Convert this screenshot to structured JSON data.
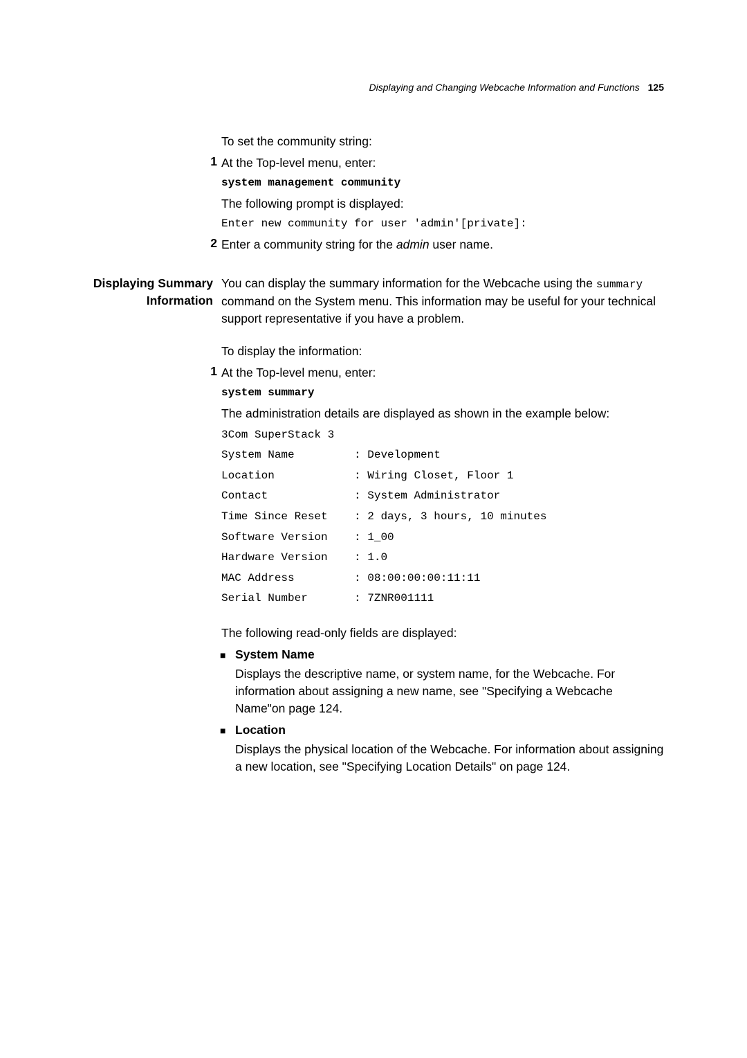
{
  "runningHead": {
    "title": "Displaying and Changing Webcache Information and Functions",
    "pageNumber": "125"
  },
  "topBlock": {
    "intro": "To set the community string:",
    "step1": "At the Top-level menu, enter:",
    "step1cmd": "system management community",
    "step1after": "The following prompt is displayed:",
    "step1output": "Enter new community for user 'admin'[private]:",
    "step2a": "Enter a community string for the ",
    "step2italic": "admin",
    "step2b": " user name.",
    "num1": "1",
    "num2": "2"
  },
  "section": {
    "sideHead": "Displaying Summary Information",
    "para1a": "You can display the summary information for the Webcache using the ",
    "para1mono": "summary",
    "para1b": " command on the System menu. This information may be useful for your technical support representative if you have a problem.",
    "para2": "To display the information:",
    "step1num": "1",
    "step1": "At the Top-level menu, enter:",
    "step1cmd": "system summary",
    "step1after": "The administration details are displayed as shown in the example below:",
    "output": "3Com SuperStack 3\nSystem Name         : Development\nLocation            : Wiring Closet, Floor 1\nContact             : System Administrator\nTime Since Reset    : 2 days, 3 hours, 10 minutes\nSoftware Version    : 1_00\nHardware Version    : 1.0\nMAC Address         : 08:00:00:00:11:11\nSerial Number       : 7ZNR001111",
    "readonlyIntro": "The following read-only fields are displayed:",
    "bullets": [
      {
        "label": "System Name",
        "desc": "Displays the descriptive name, or system name, for the Webcache. For information about assigning a new name, see \"Specifying a Webcache Name\"on page 124."
      },
      {
        "label": "Location",
        "desc": "Displays the physical location of the Webcache. For information about assigning a new location, see \"Specifying Location Details\" on page 124."
      }
    ],
    "bulletMark": "■"
  }
}
